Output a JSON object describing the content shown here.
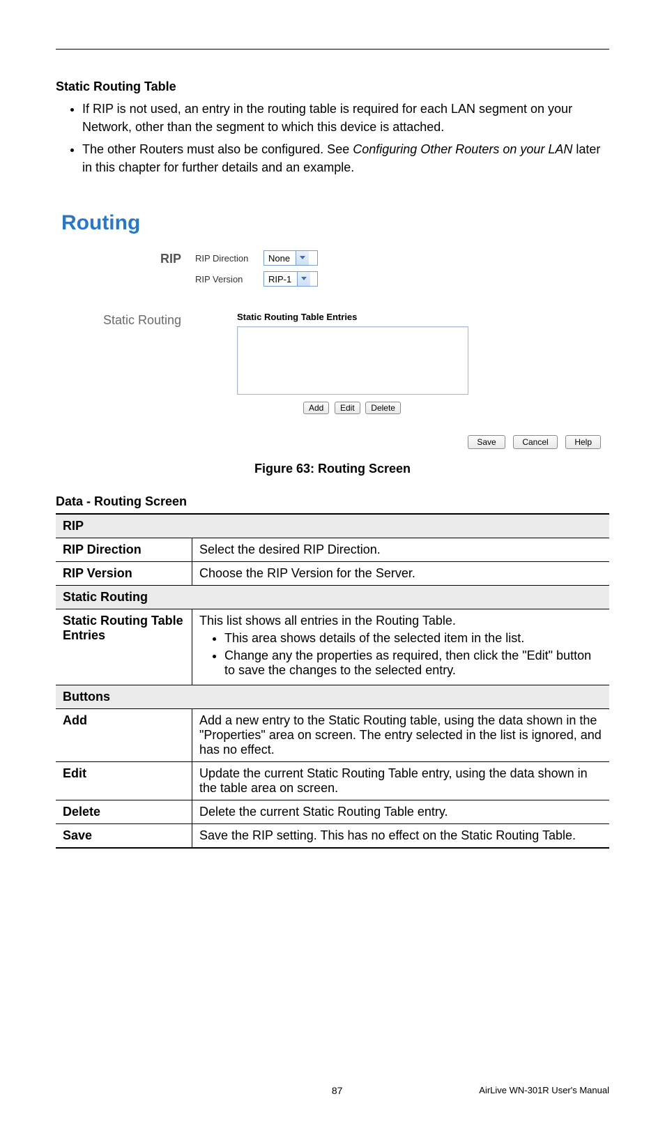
{
  "intro": {
    "heading": "Static Routing Table",
    "bullets": [
      {
        "text": "If RIP is not used, an entry in the routing table is required for each LAN segment on your Network, other than the segment to which this device is attached."
      },
      {
        "prefix": "The other Routers must also be configured. See ",
        "italic": "Configuring Other Routers on your LAN",
        "suffix": " later in this chapter for further details and an example."
      }
    ]
  },
  "screenshot": {
    "page_title": "Routing",
    "rip": {
      "section_label": "RIP",
      "direction_label": "RIP Direction",
      "direction_value": "None",
      "version_label": "RIP Version",
      "version_value": "RIP-1"
    },
    "static": {
      "section_label": "Static Routing",
      "table_heading": "Static Routing Table Entries",
      "buttons": {
        "add": "Add",
        "edit": "Edit",
        "delete": "Delete"
      }
    },
    "footer_buttons": {
      "save": "Save",
      "cancel": "Cancel",
      "help": "Help"
    }
  },
  "caption": "Figure 63: Routing Screen",
  "data_section": {
    "heading": "Data - Routing Screen",
    "sections": {
      "rip": {
        "header": "RIP",
        "rows": {
          "direction": {
            "label": "RIP Direction",
            "desc": "Select the desired RIP Direction."
          },
          "version": {
            "label": "RIP Version",
            "desc": "Choose the RIP Version for the Server."
          }
        }
      },
      "static": {
        "header": "Static Routing",
        "rows": {
          "entries": {
            "label": "Static Routing Table Entries",
            "intro": "This list shows all entries in the Routing Table.",
            "bullets": [
              "This area shows details of the selected item in the list.",
              "Change any the properties as required, then click the \"Edit\" button to save the changes to the selected entry."
            ]
          }
        }
      },
      "buttons": {
        "header": "Buttons",
        "rows": {
          "add": {
            "label": "Add",
            "desc": "Add a new entry to the Static Routing table, using the data shown in the \"Properties\" area on screen. The entry selected in the list is ignored, and has no effect."
          },
          "edit": {
            "label": "Edit",
            "desc": "Update the current Static Routing Table entry, using the data shown in the table area on screen."
          },
          "delete": {
            "label": "Delete",
            "desc": "Delete the current Static Routing Table entry."
          },
          "save": {
            "label": "Save",
            "desc": "Save the RIP setting. This has no effect on the Static Routing Table."
          }
        }
      }
    }
  },
  "footer": {
    "page": "87",
    "manual": "AirLive WN-301R User's Manual"
  }
}
